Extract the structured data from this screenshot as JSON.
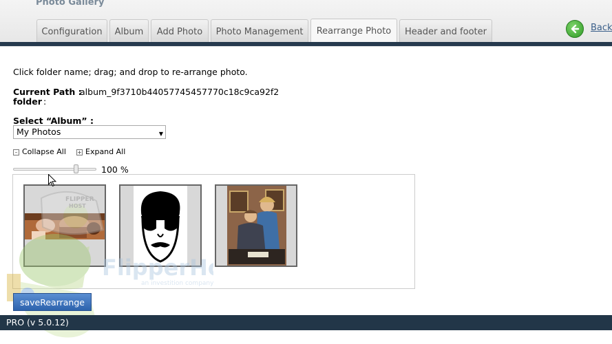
{
  "header": {
    "app_title": "Photo Gallery",
    "back_label": "Back"
  },
  "tabs": [
    {
      "label": "Configuration"
    },
    {
      "label": "Album"
    },
    {
      "label": "Add Photo"
    },
    {
      "label": "Photo Management"
    },
    {
      "label": "Rearrange Photo",
      "active": true
    },
    {
      "label": "Header and footer"
    }
  ],
  "main": {
    "instruction": "Click folder name; drag; and drop to re-arrange photo.",
    "current_path_label": "Current Path :",
    "current_path_value": "album_9f3710b44057745457770c18c9ca92f2",
    "folder_label": "folder",
    "folder_colon": ":",
    "select_album_label": "Select “Album” :",
    "album_selected": "My Photos",
    "collapse_all": "Collapse All",
    "expand_all": "Expand All",
    "zoom_text": "100 %",
    "zoom_percent": 100,
    "save_label": "saveRearrange"
  },
  "photos": [
    {
      "name": "photo-family-thumb"
    },
    {
      "name": "photo-sunglasses-cartoon-thumb"
    },
    {
      "name": "photo-couple-portrait-thumb"
    }
  ],
  "watermark": {
    "brand": "FlipperHost",
    "tagline": "an investition company",
    "cap_text": "FLIPPER HOST"
  },
  "footer": {
    "version": "PRO (v 5.0.12)"
  },
  "colors": {
    "nav_rule": "#263a4e",
    "footer_bg": "#223648",
    "button_blue": "#3d72bd",
    "back_green": "#3ca930"
  },
  "icons": {
    "back": "arrow-left-circle-icon",
    "cursor": "mouse-pointer-icon",
    "collapse": "minus-box-icon",
    "expand": "plus-box-icon"
  }
}
